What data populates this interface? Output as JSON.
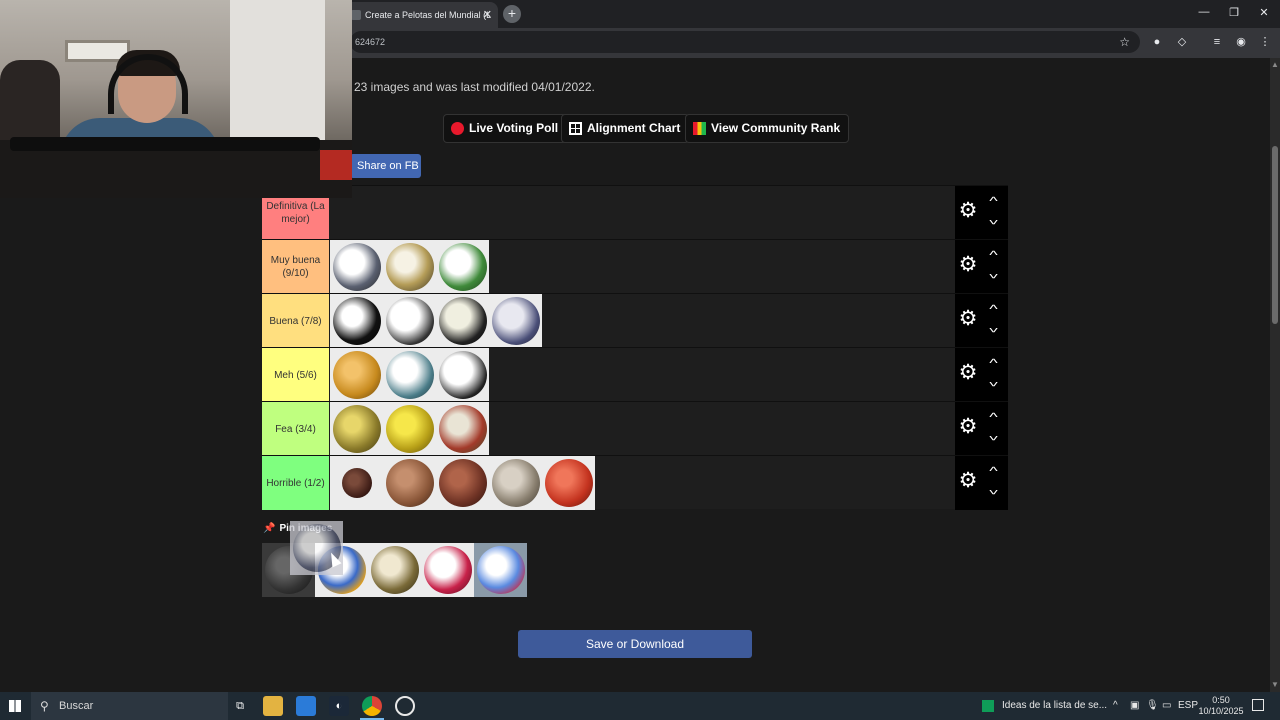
{
  "browser": {
    "tab_title": "Create a Pelotas del Mundial (L",
    "tab_close": "✕",
    "new_tab": "+",
    "address": "624672",
    "window_controls": [
      "—",
      "❐",
      "✕"
    ]
  },
  "page": {
    "info_text": "23 images and was last modified 04/01/2022.",
    "buttons": {
      "live_voting": "Live Voting Poll",
      "alignment_chart": "Alignment Chart",
      "community_rank": "View Community Rank",
      "share_fb": "Share on FB"
    },
    "tiers": [
      {
        "label": "Definitiva (La mejor)",
        "color": "#ff7f7f",
        "item_count": 0
      },
      {
        "label": "Muy buena (9/10)",
        "color": "#ffbf7f",
        "item_count": 3
      },
      {
        "label": "Buena (7/8)",
        "color": "#ffdf7f",
        "item_count": 4
      },
      {
        "label": "Meh (5/6)",
        "color": "#ffff7f",
        "item_count": 3
      },
      {
        "label": "Fea (3/4)",
        "color": "#bfff7f",
        "item_count": 3
      },
      {
        "label": "Horrible (1/2)",
        "color": "#7fff7f",
        "item_count": 5
      }
    ],
    "tier_controls": {
      "gear": "⚙",
      "up": "^",
      "down": "^"
    },
    "pin_label": "Pin images",
    "pin_icon": "📌",
    "save_button": "Save or Download"
  },
  "taskbar": {
    "search_placeholder": "Buscar",
    "news": "Ideas de la lista de se...",
    "language": "ESP",
    "time": "0:50",
    "date": "10/10/2025"
  },
  "colors": {
    "accent_blue": "#3e5a9a",
    "fb_blue": "#4267b2",
    "live_red": "#e8192c"
  }
}
